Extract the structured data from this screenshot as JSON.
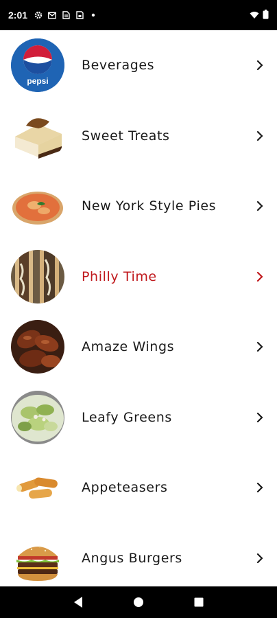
{
  "status_bar": {
    "time": "2:01",
    "left_icons": [
      "gear-icon",
      "gmail-icon",
      "document-icon",
      "save-icon",
      "dot-icon"
    ],
    "right_icons": [
      "wifi-icon",
      "battery-icon"
    ]
  },
  "menu": {
    "items": [
      {
        "label": "Beverages",
        "image": "pepsi-logo"
      },
      {
        "label": "Sweet Treats",
        "image": "cheesecake-photo"
      },
      {
        "label": "New York Style Pies",
        "image": "pizza-photo"
      },
      {
        "label": "Philly Time",
        "image": "philly-sandwich-photo",
        "active": true
      },
      {
        "label": "Amaze Wings",
        "image": "wings-photo"
      },
      {
        "label": "Leafy Greens",
        "image": "salad-photo"
      },
      {
        "label": "Appeteasers",
        "image": "mozzarella-sticks-photo"
      },
      {
        "label": "Angus Burgers",
        "image": "burger-photo"
      }
    ],
    "logo_text": "pepsi",
    "active_color": "#c0181c",
    "text_color": "#1a1a1a"
  },
  "nav_bar": {
    "buttons": [
      "back-icon",
      "home-icon",
      "recents-icon"
    ]
  }
}
